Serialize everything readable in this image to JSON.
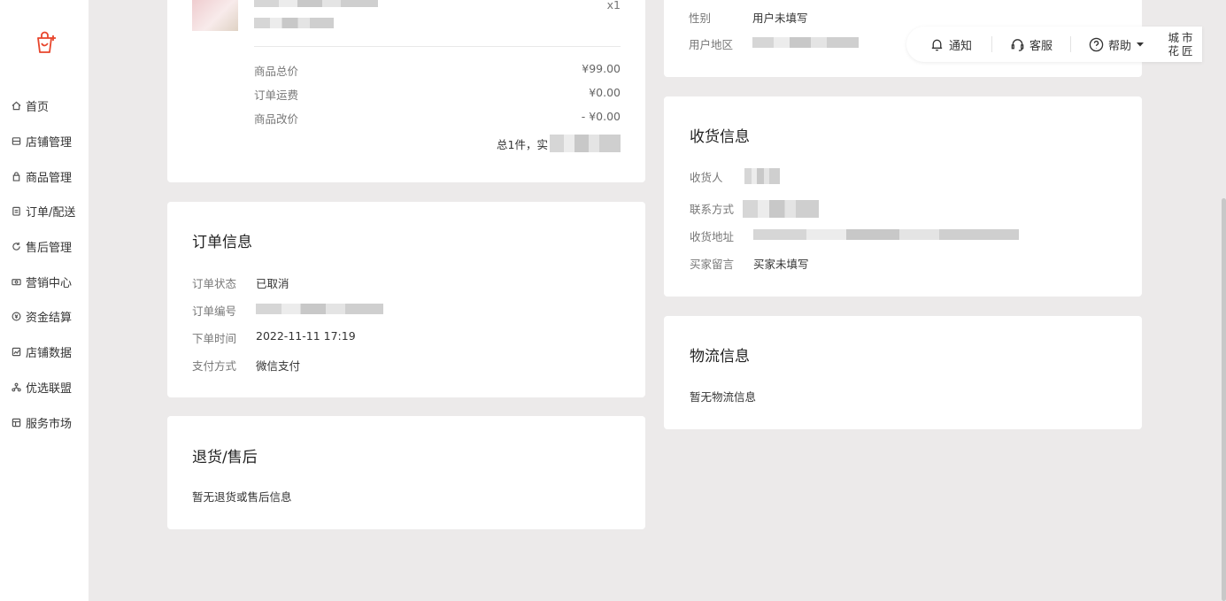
{
  "sidebar": {
    "items": [
      {
        "label": "首页",
        "icon": "home-icon"
      },
      {
        "label": "店铺管理",
        "icon": "store-icon"
      },
      {
        "label": "商品管理",
        "icon": "bag-icon"
      },
      {
        "label": "订单/配送",
        "icon": "order-icon"
      },
      {
        "label": "售后管理",
        "icon": "refresh-icon"
      },
      {
        "label": "营销中心",
        "icon": "coupon-icon"
      },
      {
        "label": "资金结算",
        "icon": "money-icon"
      },
      {
        "label": "店铺数据",
        "icon": "chart-icon"
      },
      {
        "label": "优选联盟",
        "icon": "network-icon"
      },
      {
        "label": "服务市场",
        "icon": "market-icon"
      }
    ]
  },
  "topbar": {
    "notify": "通知",
    "service": "客服",
    "help": "帮助",
    "shop_name": "城市花匠"
  },
  "product_card": {
    "qty": "x1",
    "rows": [
      {
        "label": "商品总价",
        "value": "¥99.00"
      },
      {
        "label": "订单运费",
        "value": "¥0.00"
      },
      {
        "label": "商品改价",
        "value": "- ¥0.00"
      }
    ],
    "total_prefix": "总1件，实"
  },
  "buyer_card": {
    "gender_label": "性别",
    "gender_value": "用户未填写",
    "region_label": "用户地区"
  },
  "order_info": {
    "title": "订单信息",
    "status_label": "订单状态",
    "status_value": "已取消",
    "number_label": "订单编号",
    "time_label": "下单时间",
    "time_value": "2022-11-11 17:19",
    "pay_label": "支付方式",
    "pay_value": "微信支付"
  },
  "aftersale": {
    "title": "退货/售后",
    "empty": "暂无退货或售后信息"
  },
  "shipping": {
    "title": "收货信息",
    "receiver_label": "收货人",
    "contact_label": "联系方式",
    "address_label": "收货地址",
    "message_label": "买家留言",
    "message_value": "买家未填写"
  },
  "logistics": {
    "title": "物流信息",
    "empty": "暂无物流信息"
  },
  "colors": {
    "brand": "#e8452c",
    "background": "#eceaea"
  }
}
